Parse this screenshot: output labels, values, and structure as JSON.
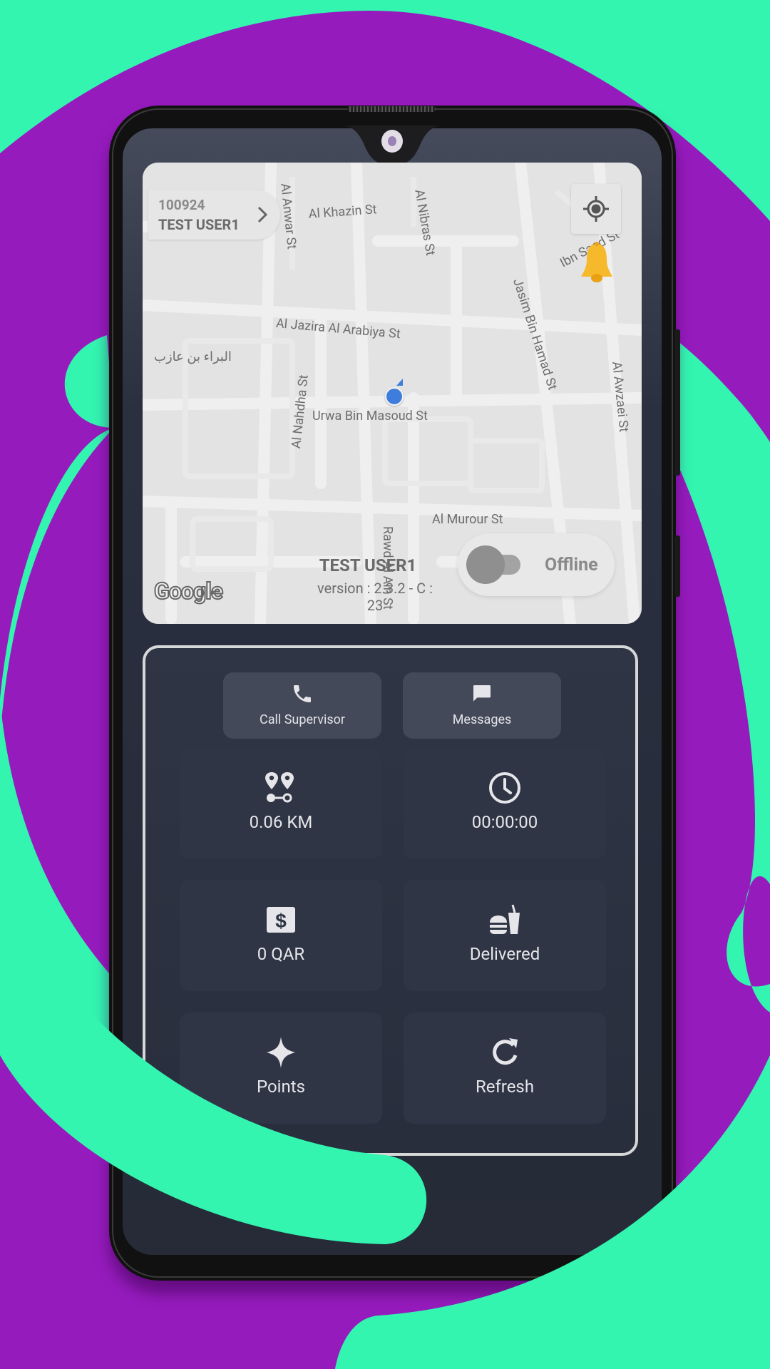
{
  "theme": {
    "background_purple": "#961BBD",
    "background_green": "#33F5B0",
    "screen_dark": "#282E3C",
    "tile": "#2F3545",
    "action_button": "#434958",
    "location_blue": "#3F7DDC",
    "bell_yellow": "#F6B92B"
  },
  "map": {
    "user_chip": {
      "id": "100924",
      "name": "TEST USER1",
      "chevron_icon": "chevron-right-icon"
    },
    "locate_icon": "my-location-icon",
    "notification_icon": "bell-icon",
    "streets": [
      "Al Khazin St",
      "Al Anwar St",
      "Al Nibras St",
      "Ibn Saad St",
      "Al Jazira Al Arabiya St",
      "Jasim Bin Hamad St",
      "البراء بن عازب",
      "Al Nahdha St",
      "Urwa Bin Masoud St",
      "Al Awzaei St",
      "Al Murour St",
      "Rawd Al Ain St"
    ],
    "attribution": "Google",
    "driver_name": "TEST USER1",
    "version": "version : 2.3.2 - C : 23",
    "status": {
      "label": "Offline",
      "online": false
    }
  },
  "panel": {
    "actions": [
      {
        "label": "Call Supervisor",
        "icon": "phone-icon"
      },
      {
        "label": "Messages",
        "icon": "message-icon"
      }
    ],
    "tiles": [
      {
        "label": "0.06 KM",
        "icon": "route-icon"
      },
      {
        "label": "00:00:00",
        "icon": "clock-icon"
      },
      {
        "label": "0 QAR",
        "icon": "dollar-icon"
      },
      {
        "label": "Delivered",
        "icon": "fastfood-icon"
      },
      {
        "label": "Points",
        "icon": "sparkle-icon"
      },
      {
        "label": "Refresh",
        "icon": "refresh-icon"
      }
    ]
  }
}
